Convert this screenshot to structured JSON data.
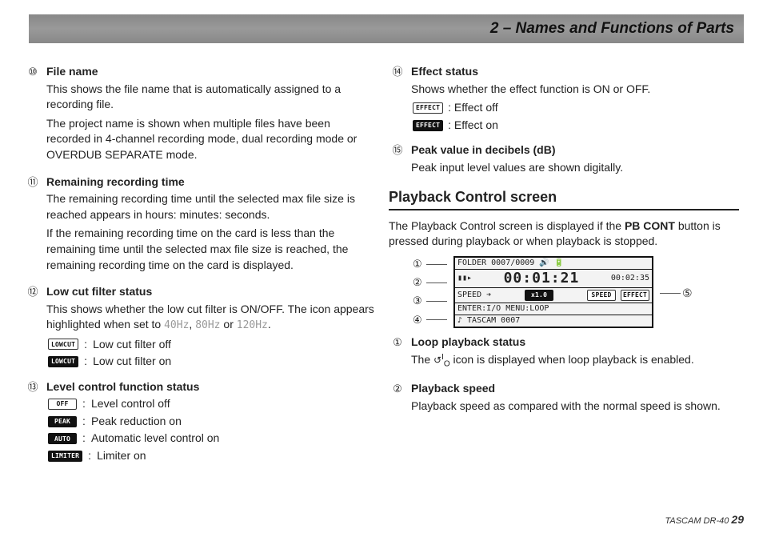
{
  "header": {
    "title": "2 – Names and Functions of Parts"
  },
  "footer": {
    "product": "TASCAM DR-40",
    "page": "29"
  },
  "section": {
    "playback_control_title": "Playback Control screen"
  },
  "left": {
    "items": [
      {
        "marker": "⑩",
        "title": "File name",
        "paras": [
          "This shows the file name that is automatically assigned to a recording file.",
          "The project name is shown when multiple files have been recorded in 4-channel recording mode, dual recording mode or OVERDUB SEPARATE mode."
        ]
      },
      {
        "marker": "⑪",
        "title": "Remaining recording time",
        "paras": [
          "The remaining recording time until the selected max file size is reached appears in hours: minutes: seconds.",
          "If the remaining recording time on the card is less than the remaining time until the selected max file size is reached, the remaining recording time on the card is displayed."
        ]
      },
      {
        "marker": "⑫",
        "title": "Low cut filter status",
        "intro_pre": "This shows whether the low cut filter is ON/OFF. The icon appears highlighted when set to ",
        "freqs": [
          "40Hz",
          "80Hz",
          "120Hz"
        ],
        "icons": [
          {
            "style": "hollow",
            "label": "LOWCUT",
            "text": "Low cut filter off"
          },
          {
            "style": "fill",
            "label": "LOWCUT",
            "text": "Low cut filter on"
          }
        ]
      },
      {
        "marker": "⑬",
        "title": "Level control function status",
        "icons": [
          {
            "style": "hollow",
            "label": "OFF",
            "text": "Level control off"
          },
          {
            "style": "fill",
            "label": "PEAK",
            "text": "Peak reduction on"
          },
          {
            "style": "fill",
            "label": "AUTO",
            "text": "Automatic level control on"
          },
          {
            "style": "fill",
            "label": "LIMITER",
            "text": "Limiter on"
          }
        ]
      }
    ]
  },
  "right": {
    "items": [
      {
        "marker": "⑭",
        "title": "Effect status",
        "paras": [
          "Shows whether the effect function is ON or OFF."
        ],
        "icons": [
          {
            "style": "hollow",
            "label": "EFFECT",
            "text": "Effect off"
          },
          {
            "style": "fill",
            "label": "EFFECT",
            "text": "Effect on"
          }
        ]
      },
      {
        "marker": "⑮",
        "title": "Peak value in decibels (dB)",
        "paras": [
          "Peak input level values are shown digitally."
        ]
      }
    ],
    "playback_intro_pre": "The Playback Control screen is displayed if the ",
    "playback_intro_bold": "PB CONT",
    "playback_intro_post": " button is pressed during playback or when playback is stopped.",
    "lcd": {
      "row1": "FOLDER 0007/0009     🔊 🔋",
      "row2_left": "▮▮▸",
      "row2_mid": "00:01:21",
      "row2_right": "00:02:35",
      "row3_left": "SPEED ➔",
      "row3_mid": "x1.0",
      "row3_right_a": "SPEED",
      "row3_right_b": "EFFECT",
      "row4": "ENTER:I/O  MENU:LOOP",
      "row5": "♪ TASCAM 0007"
    },
    "callouts_left": [
      "①",
      "②",
      "③",
      "④"
    ],
    "callout_right": "⑤",
    "playback_items": [
      {
        "marker": "①",
        "title": "Loop playback status",
        "loop_pre": "The ",
        "loop_post": " icon is displayed when loop playback is enabled."
      },
      {
        "marker": "②",
        "title": "Playback speed",
        "paras": [
          "Playback speed as compared with the normal speed is shown."
        ]
      }
    ]
  }
}
